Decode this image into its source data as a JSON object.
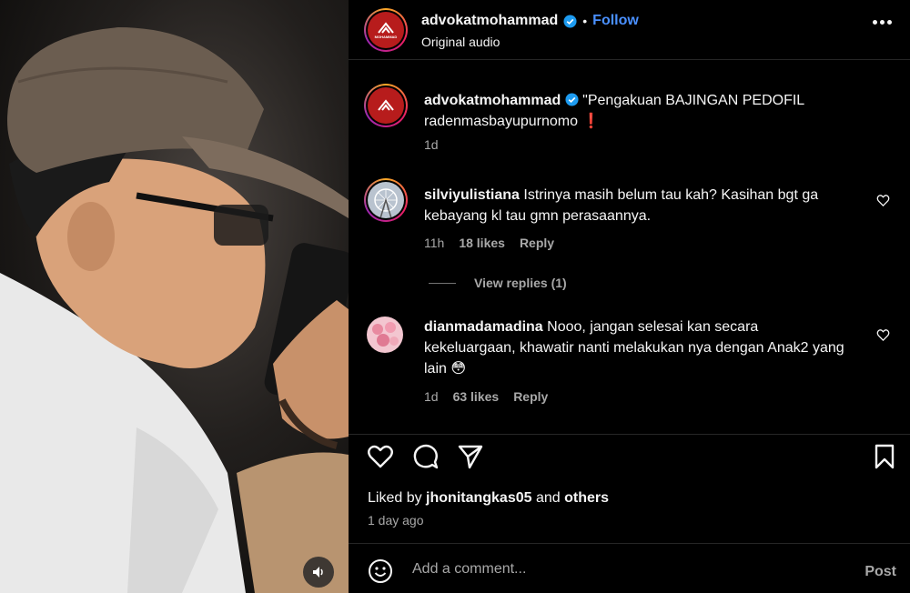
{
  "header": {
    "username": "advokatmohammad",
    "follow_label": "Follow",
    "dot": "•",
    "subtitle": "Original audio",
    "logo_text": "MOHAMMAD"
  },
  "caption": {
    "username": "advokatmohammad",
    "text": "\"Pengakuan BAJINGAN PEDOFIL radenmasbayupurnomo",
    "emoji": "❗",
    "age": "1d"
  },
  "comments": [
    {
      "username": "silviyulistiana",
      "text": "Istrinya masih belum tau kah? Kasihan bgt ga kebayang kl tau gmn perasaannya.",
      "age": "11h",
      "likes": "18 likes",
      "reply": "Reply"
    },
    {
      "username": "dianmadamadina",
      "text": "Nooo, jangan selesai kan secara kekeluargaan, khawatir nanti melakukan nya dengan Anak2 yang lain",
      "emoji": "😳",
      "age": "1d",
      "likes": "63 likes",
      "reply": "Reply"
    }
  ],
  "view_replies": "View replies (1)",
  "actions": {
    "liked_prefix": "Liked by",
    "liked_user": "jhonitangkas05",
    "liked_and": "and",
    "liked_others": "others",
    "time": "1 day ago"
  },
  "add_comment": {
    "placeholder": "Add a comment...",
    "post_label": "Post"
  },
  "icons": [
    "heart-icon",
    "comment-icon",
    "share-icon",
    "bookmark-icon",
    "emoji-icon",
    "more-icon",
    "verified-icon",
    "speaker-icon"
  ],
  "colors": {
    "accent": "#4a90ff",
    "verified": "#1d9bf0",
    "brand": "#b71c1c"
  }
}
